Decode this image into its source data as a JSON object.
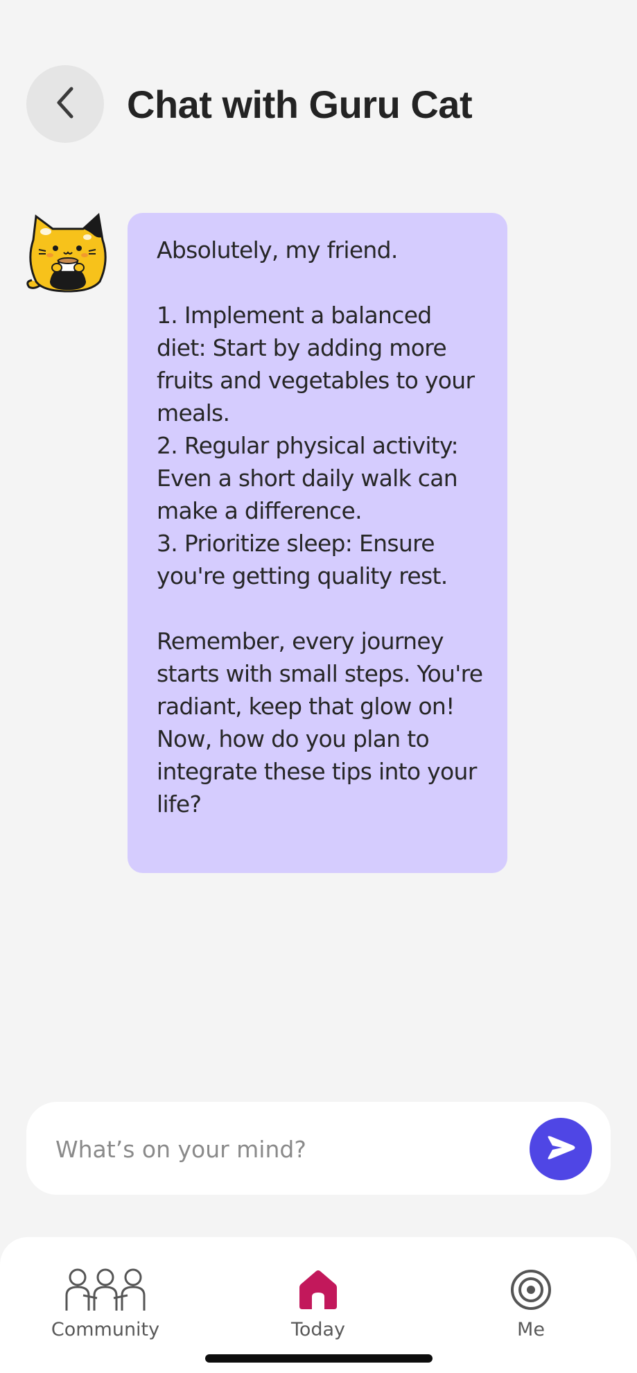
{
  "header": {
    "title": "Chat with Guru Cat",
    "back_icon": "chevron-left-icon"
  },
  "chat": {
    "avatar_icon": "guru-cat-avatar",
    "message": "Absolutely, my friend.\n\n1. Implement a balanced diet: Start by adding more fruits and vegetables to your meals.\n2. Regular physical activity: Even a short daily walk can make a difference.\n3. Prioritize sleep: Ensure you're getting quality rest.\n\nRemember, every journey starts with small steps. You're radiant, keep that glow on! Now, how do you plan to integrate these tips into your life?",
    "bubble_color": "#d5ccfe"
  },
  "composer": {
    "placeholder": "What’s on your mind?",
    "value": "",
    "send_icon": "send-icon",
    "send_color": "#4f46e5"
  },
  "tabs": [
    {
      "label": "Community",
      "icon": "community-icon",
      "active": false
    },
    {
      "label": "Today",
      "icon": "home-icon",
      "active": true,
      "color": "#c2185b"
    },
    {
      "label": "Me",
      "icon": "target-icon",
      "active": false
    }
  ]
}
